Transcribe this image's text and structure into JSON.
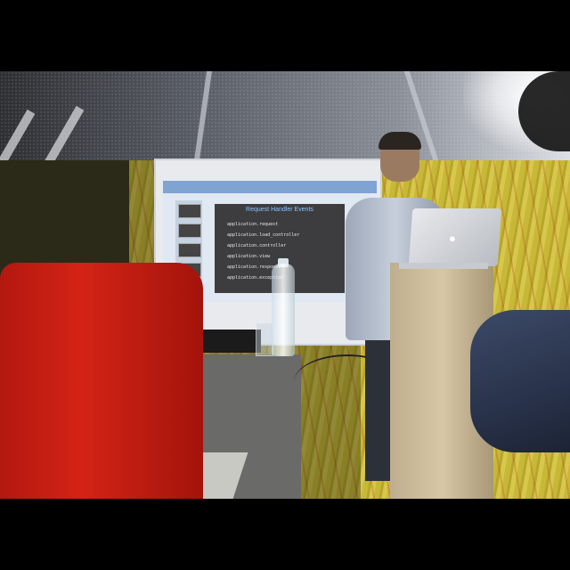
{
  "scene": {
    "description_labels": {
      "slide_title": "Request Handler Events",
      "slide_lines": [
        "application.request",
        "application.load_controller",
        "application.controller",
        "application.view",
        "application.response",
        "application.exception"
      ]
    },
    "icons": [
      "apple-logo-icon"
    ],
    "colors": {
      "chair_red": "#d42316",
      "wall_yellow": "#c8b838",
      "slide_bg": "#3d3d40",
      "slide_title": "#8ec2ff"
    }
  }
}
